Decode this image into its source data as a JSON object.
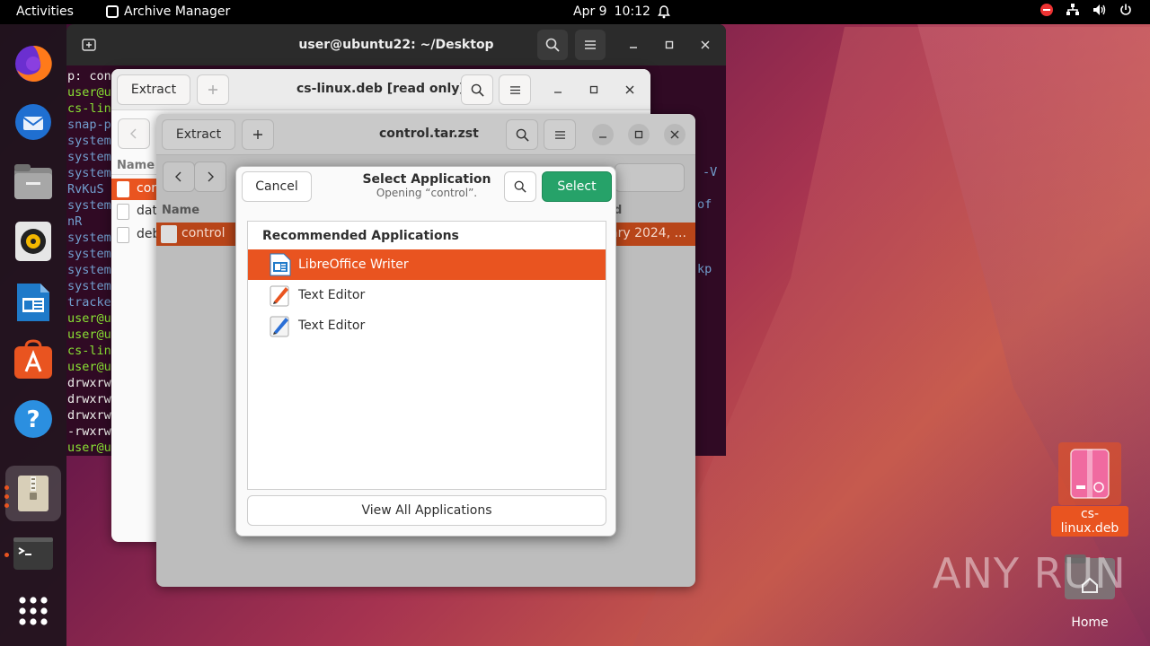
{
  "topbar": {
    "activities": "Activities",
    "app_name": "Archive Manager",
    "date": "Apr 9",
    "time": "10:12"
  },
  "terminal": {
    "title": "user@ubuntu22: ~/Desktop",
    "lines": [
      {
        "text": "p: con",
        "cls": "w"
      },
      {
        "text": "user@u",
        "cls": "g"
      },
      {
        "text": "cs-lin",
        "cls": "g"
      },
      {
        "text": "snap-p",
        "cls": "b"
      },
      {
        "text": "system",
        "cls": "b"
      },
      {
        "text": "system",
        "cls": "b"
      },
      {
        "text": "system",
        "cls": "b"
      },
      {
        "text": "RvKuS",
        "cls": "b"
      },
      {
        "text": "system",
        "cls": "b"
      },
      {
        "text": "nR",
        "cls": "b"
      },
      {
        "text": "system",
        "cls": "b"
      },
      {
        "text": "system",
        "cls": "b"
      },
      {
        "text": "system",
        "cls": "b"
      },
      {
        "text": "system",
        "cls": "b"
      },
      {
        "text": "tracke",
        "cls": "b"
      },
      {
        "text": "user@u",
        "cls": "g"
      },
      {
        "text": "user@u",
        "cls": "g"
      },
      {
        "text": "cs-lin",
        "cls": "g"
      },
      {
        "text": "user@u",
        "cls": "g"
      },
      {
        "text": "drwxrw",
        "cls": "w"
      },
      {
        "text": "drwxrw",
        "cls": "w"
      },
      {
        "text": "drwxrw",
        "cls": "w"
      },
      {
        "text": "-rwxrw",
        "cls": "w"
      },
      {
        "text": "user@u",
        "cls": "g"
      }
    ],
    "right_fragments": [
      "-V",
      "of",
      "kp"
    ]
  },
  "archive_back": {
    "extract_label": "Extract",
    "title": "cs-linux.deb [read only]",
    "column_name": "Name",
    "files": [
      "con",
      "dat",
      "deb"
    ]
  },
  "archive_front": {
    "extract_label": "Extract",
    "title": "control.tar.zst",
    "column_name": "Name",
    "column_modified_fragment": "d",
    "file_name": "control",
    "file_modified_fragment": "ary 2024, ..."
  },
  "dialog": {
    "cancel_label": "Cancel",
    "title": "Select Application",
    "subtitle": "Opening “control”.",
    "select_label": "Select",
    "section_header": "Recommended Applications",
    "apps": [
      {
        "name": "LibreOffice Writer",
        "icon": "libreoffice-writer-icon",
        "selected": true
      },
      {
        "name": "Text Editor",
        "icon": "text-editor-orange-icon",
        "selected": false
      },
      {
        "name": "Text Editor",
        "icon": "text-editor-blue-icon",
        "selected": false
      }
    ],
    "view_all_label": "View All Applications"
  },
  "desktop": {
    "file_label": "cs-linux.deb",
    "home_label": "Home"
  },
  "watermark": "ANY RUN",
  "colors": {
    "accent": "#e95420",
    "select_green": "#26a269",
    "terminal_bg": "#300a24"
  }
}
